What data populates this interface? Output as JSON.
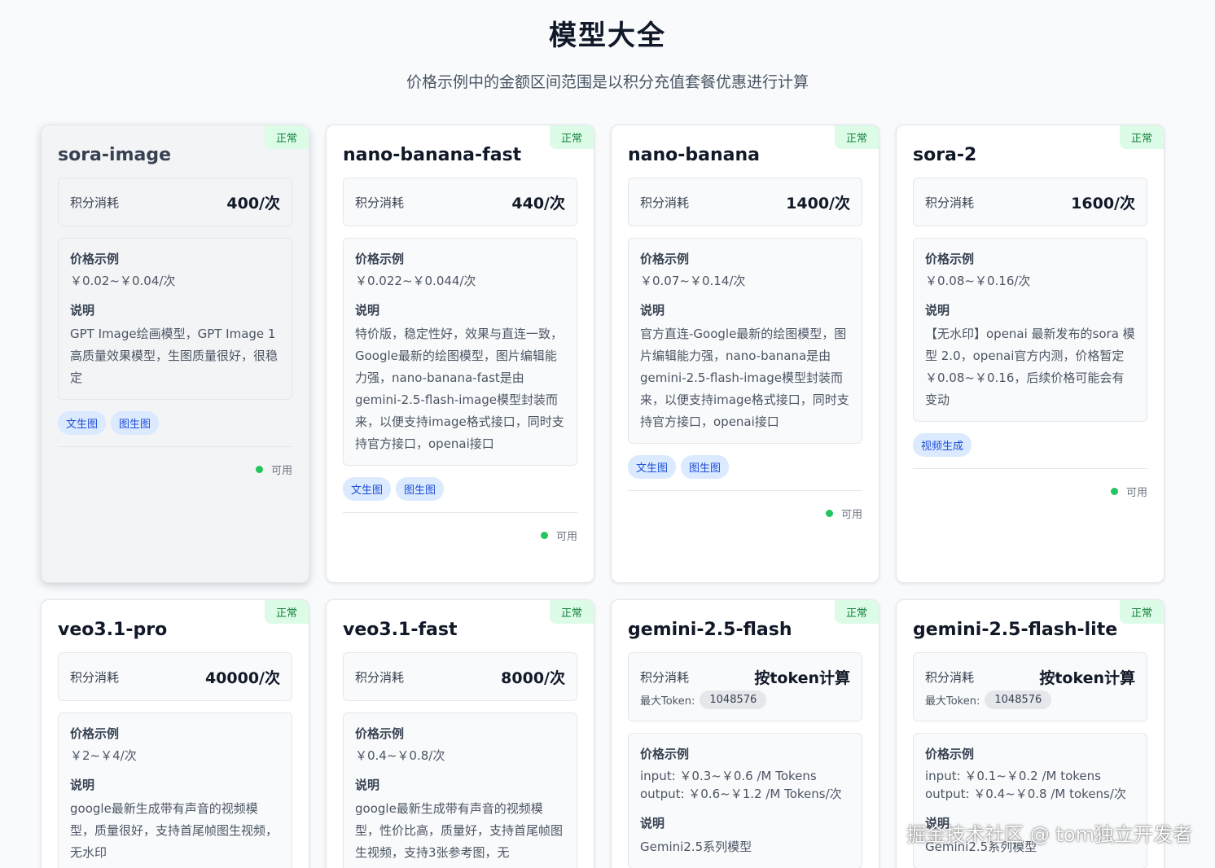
{
  "page": {
    "title": "模型大全",
    "subtitle": "价格示例中的金额区间范围是以积分充值套餐优惠进行计算"
  },
  "labels": {
    "cost": "积分消耗",
    "price_example": "价格示例",
    "description": "说明",
    "max_token": "最大Token:",
    "available": "可用"
  },
  "cards": [
    {
      "name": "sora-image",
      "status": "正常",
      "cost": "400/次",
      "price": "￥0.02~￥0.04/次",
      "description": "GPT Image绘画模型，GPT Image 1高质量效果模型，生图质量很好，很稳定",
      "tags": [
        "文生图",
        "图生图"
      ]
    },
    {
      "name": "nano-banana-fast",
      "status": "正常",
      "cost": "440/次",
      "price": "￥0.022~￥0.044/次",
      "description": "特价版，稳定性好，效果与直连一致，Google最新的绘图模型，图片编辑能力强，nano-banana-fast是由gemini-2.5-flash-image模型封装而来，以便支持image格式接口，同时支持官方接口，openai接口",
      "tags": [
        "文生图",
        "图生图"
      ]
    },
    {
      "name": "nano-banana",
      "status": "正常",
      "cost": "1400/次",
      "price": "￥0.07~￥0.14/次",
      "description": "官方直连-Google最新的绘图模型，图片编辑能力强，nano-banana是由gemini-2.5-flash-image模型封装而来，以便支持image格式接口，同时支持官方接口，openai接口",
      "tags": [
        "文生图",
        "图生图"
      ]
    },
    {
      "name": "sora-2",
      "status": "正常",
      "cost": "1600/次",
      "price": "￥0.08~￥0.16/次",
      "description": "【无水印】openai 最新发布的sora 模型 2.0，openai官方内测，价格暂定￥0.08~￥0.16，后续价格可能会有变动",
      "tags": [
        "视频生成"
      ]
    },
    {
      "name": "veo3.1-pro",
      "status": "正常",
      "cost": "40000/次",
      "price": "￥2~￥4/次",
      "description": "google最新生成带有声音的视频模型，质量很好，支持首尾帧图生视频，无水印"
    },
    {
      "name": "veo3.1-fast",
      "status": "正常",
      "cost": "8000/次",
      "price": "￥0.4~￥0.8/次",
      "description": "google最新生成带有声音的视频模型，性价比高，质量好，支持首尾帧图生视频，支持3张参考图，无"
    },
    {
      "name": "gemini-2.5-flash",
      "status": "正常",
      "cost": "按token计算",
      "max_token": "1048576",
      "price_input": "input: ￥0.3~￥0.6 /M Tokens",
      "price_output": "output: ￥0.6~￥1.2 /M Tokens/次",
      "description": "Gemini2.5系列模型"
    },
    {
      "name": "gemini-2.5-flash-lite",
      "status": "正常",
      "cost": "按token计算",
      "max_token": "1048576",
      "price_input": "input: ￥0.1~￥0.2 /M tokens",
      "price_output": "output: ￥0.4~￥0.8 /M tokens/次",
      "description": "Gemini2.5系列模型"
    }
  ],
  "watermark": "掘金技术社区 @ tom独立开发者"
}
